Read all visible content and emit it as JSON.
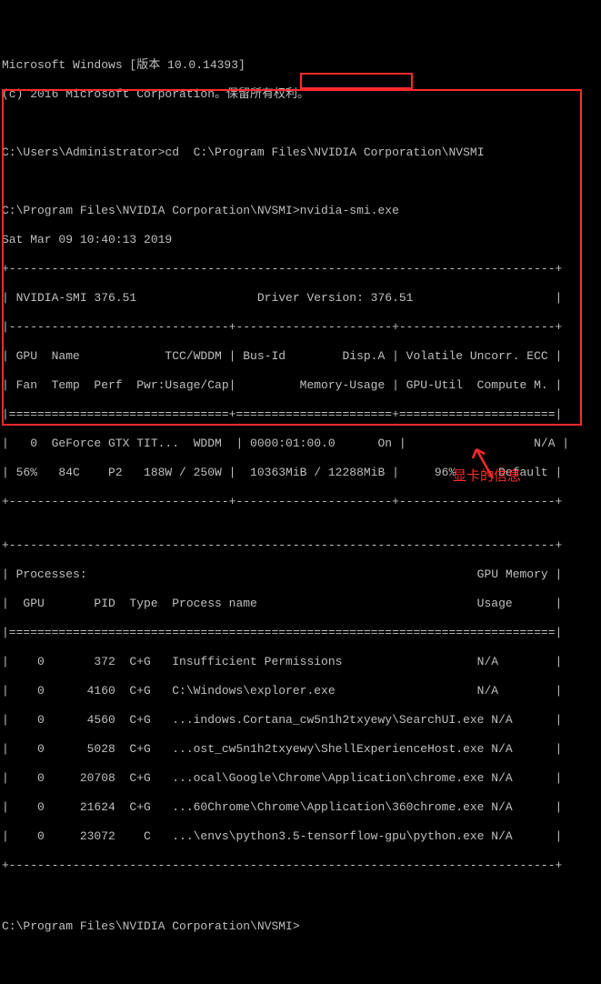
{
  "header": {
    "line1": "Microsoft Windows [版本 10.0.14393]",
    "line2": "(c) 2016 Microsoft Corporation。保留所有权利。"
  },
  "prompts": {
    "p1": "C:\\Users\\Administrator>",
    "cmd1": "cd  C:\\Program Files\\NVIDIA Corporation\\NVSMI",
    "p2": "C:\\Program Files\\NVIDIA Corporation\\NVSMI>",
    "cmd2": "nvidia-smi.exe",
    "p3": "C:\\Program Files\\NVIDIA Corporation\\NVSMI>"
  },
  "nvsmi": {
    "timestamp": "Sat Mar 09 10:40:13 2019",
    "border_top": "+-----------------------------------------------------------------------------+",
    "row_title": "| NVIDIA-SMI 376.51                 Driver Version: 376.51                    |",
    "row_sep_a": "|-------------------------------+----------------------+----------------------+",
    "row_hdr1": "| GPU  Name            TCC/WDDM | Bus-Id        Disp.A | Volatile Uncorr. ECC |",
    "row_hdr2": "| Fan  Temp  Perf  Pwr:Usage/Cap|         Memory-Usage | GPU-Util  Compute M. |",
    "row_sep_b": "|===============================+======================+======================|",
    "row_gpu1": "|   0  GeForce GTX TIT...  WDDM  | 0000:01:00.0      On |                  N/A |",
    "row_gpu2": "| 56%   84C    P2   188W / 250W |  10363MiB / 12288MiB |     96%      Default |",
    "row_sep_c": "+-------------------------------+----------------------+----------------------+",
    "blank": "",
    "proc_top": "+-----------------------------------------------------------------------------+",
    "proc_h1": "| Processes:                                                       GPU Memory |",
    "proc_h2": "|  GPU       PID  Type  Process name                               Usage      |",
    "proc_sep": "|=============================================================================|",
    "proc_r1": "|    0       372  C+G   Insufficient Permissions                   N/A        |",
    "proc_r2": "|    0      4160  C+G   C:\\Windows\\explorer.exe                    N/A        |",
    "proc_r3": "|    0      4560  C+G   ...indows.Cortana_cw5n1h2txyewy\\SearchUI.exe N/A      |",
    "proc_r4": "|    0      5028  C+G   ...ost_cw5n1h2txyewy\\ShellExperienceHost.exe N/A      |",
    "proc_r5": "|    0     20708  C+G   ...ocal\\Google\\Chrome\\Application\\chrome.exe N/A      |",
    "proc_r6": "|    0     21624  C+G   ...60Chrome\\Chrome\\Application\\360chrome.exe N/A      |",
    "proc_r7": "|    0     23072    C   ...\\envs\\python3.5-tensorflow-gpu\\python.exe N/A      |",
    "proc_bot": "+-----------------------------------------------------------------------------+"
  },
  "annotation": {
    "caption": "显卡的信息"
  }
}
